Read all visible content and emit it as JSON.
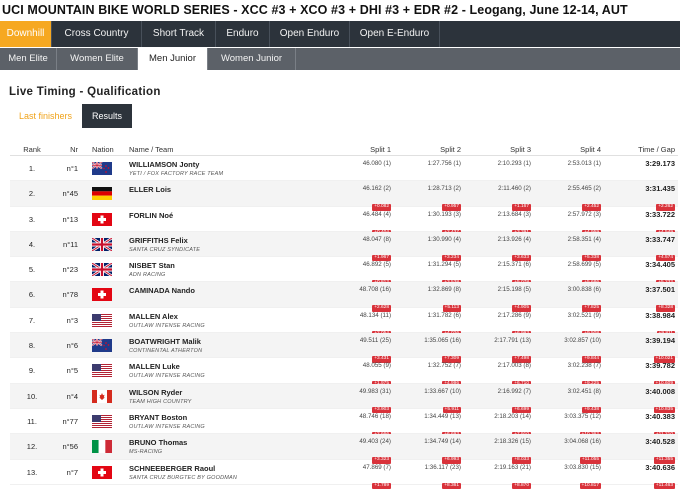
{
  "page": {
    "title": "UCI MOUNTAIN BIKE WORLD SERIES - XCC #3 + XCO #3 + DHI #3 + EDR #2 - Leogang, June 12-14, AUT"
  },
  "disciplines": [
    {
      "label": "Downhill",
      "active": true
    },
    {
      "label": "Cross Country",
      "active": false
    },
    {
      "label": "Short Track",
      "active": false
    },
    {
      "label": "Enduro",
      "active": false
    },
    {
      "label": "Open Enduro",
      "active": false
    },
    {
      "label": "Open E-Enduro",
      "active": false
    }
  ],
  "categories": [
    {
      "label": "Men Elite",
      "active": false
    },
    {
      "label": "Women Elite",
      "active": false
    },
    {
      "label": "Men Junior",
      "active": true
    },
    {
      "label": "Women Junior",
      "active": false
    }
  ],
  "section": {
    "title": "Live Timing - Qualification"
  },
  "subtabs": [
    {
      "label": "Last finishers",
      "active": false
    },
    {
      "label": "Results",
      "active": true
    }
  ],
  "colors": {
    "accent": "#f6a821",
    "nav_dark": "#2c333b",
    "nav_grey": "#5c6168",
    "gap_badge": "#d9323a"
  },
  "columns": {
    "rank": "Rank",
    "nr": "Nr",
    "nation": "Nation",
    "name_team": "Name / Team",
    "split1": "Split 1",
    "split2": "Split 2",
    "split3": "Split 3",
    "split4": "Split 4",
    "time_gap": "Time / Gap"
  },
  "rows": [
    {
      "rank": "1.",
      "nr": "n°1",
      "flag": "nz",
      "name": "WILLIAMSON Jonty",
      "team": "YETI / FOX FACTORY RACE TEAM",
      "s1": "46.080 (1)",
      "s1g": "",
      "s2": "1:27.756 (1)",
      "s2g": "",
      "s3": "2:10.293 (1)",
      "s3g": "",
      "s4": "2:53.013 (1)",
      "s4g": "",
      "time": "3:29.173",
      "gap": ""
    },
    {
      "rank": "2.",
      "nr": "n°45",
      "flag": "de",
      "name": "ELLER Lois",
      "team": "",
      "s1": "46.162 (2)",
      "s1g": "+0.082",
      "s2": "1:28.713 (2)",
      "s2g": "+0.957",
      "s3": "2:11.460 (2)",
      "s3g": "+1.167",
      "s4": "2:55.465 (2)",
      "s4g": "+2.452",
      "time": "3:31.435",
      "gap": "+2.262"
    },
    {
      "rank": "3.",
      "nr": "n°13",
      "flag": "ch",
      "name": "FORLIN Noé",
      "team": "",
      "s1": "46.484 (4)",
      "s1g": "+0.404",
      "s2": "1:30.193 (3)",
      "s2g": "+2.437",
      "s3": "2:13.684 (3)",
      "s3g": "+3.391",
      "s4": "2:57.972 (3)",
      "s4g": "+4.959",
      "time": "3:33.722",
      "gap": "+4.549"
    },
    {
      "rank": "4.",
      "nr": "n°11",
      "flag": "gb",
      "name": "GRIFFITHS Felix",
      "team": "SANTA CRUZ SYNDICATE",
      "s1": "48.047 (8)",
      "s1g": "+1.967",
      "s2": "1:30.990 (4)",
      "s2g": "+3.234",
      "s3": "2:13.926 (4)",
      "s3g": "+3.633",
      "s4": "2:58.351 (4)",
      "s4g": "+5.338",
      "time": "3:33.747",
      "gap": "+4.574"
    },
    {
      "rank": "5.",
      "nr": "n°23",
      "flag": "gb",
      "name": "NISBET Stan",
      "team": "ADN RACING",
      "s1": "46.892 (5)",
      "s1g": "+0.812",
      "s2": "1:31.294 (5)",
      "s2g": "+3.538",
      "s3": "2:15.371 (6)",
      "s3g": "+5.078",
      "s4": "2:58.699 (5)",
      "s4g": "+5.686",
      "time": "3:34.405",
      "gap": "+5.232"
    },
    {
      "rank": "6.",
      "nr": "n°78",
      "flag": "ch",
      "name": "CAMINADA Nando",
      "team": "",
      "s1": "48.708 (16)",
      "s1g": "+2.628",
      "s2": "1:32.869 (8)",
      "s2g": "+5.113",
      "s3": "2:15.198 (5)",
      "s3g": "+4.905",
      "s4": "3:00.838 (6)",
      "s4g": "+7.825",
      "time": "3:37.501",
      "gap": "+8.328"
    },
    {
      "rank": "7.",
      "nr": "n°3",
      "flag": "us",
      "name": "MALLEN Alex",
      "team": "OUTLAW INTENSE RACING",
      "s1": "48.134 (11)",
      "s1g": "+2.054",
      "s2": "1:31.782 (6)",
      "s2g": "+4.026",
      "s3": "2:17.286 (9)",
      "s3g": "+6.993",
      "s4": "3:02.521 (9)",
      "s4g": "+9.508",
      "time": "3:38.984",
      "gap": "+9.811"
    },
    {
      "rank": "8.",
      "nr": "n°6",
      "flag": "nz",
      "name": "BOATWRIGHT Malik",
      "team": "CONTINENTAL ATHERTON",
      "s1": "49.511 (25)",
      "s1g": "+3.431",
      "s2": "1:35.065 (16)",
      "s2g": "+7.309",
      "s3": "2:17.791 (13)",
      "s3g": "+7.498",
      "s4": "3:02.857 (10)",
      "s4g": "+9.844",
      "time": "3:39.194",
      "gap": "+10.021"
    },
    {
      "rank": "9.",
      "nr": "n°5",
      "flag": "us",
      "name": "MALLEN Luke",
      "team": "OUTLAW INTENSE RACING",
      "s1": "48.055 (9)",
      "s1g": "+1.975",
      "s2": "1:32.752 (7)",
      "s2g": "+4.996",
      "s3": "2:17.003 (8)",
      "s3g": "+6.710",
      "s4": "3:02.238 (7)",
      "s4g": "+9.225",
      "time": "3:39.782",
      "gap": "+10.609"
    },
    {
      "rank": "10.",
      "nr": "n°4",
      "flag": "ca",
      "name": "WILSON Ryder",
      "team": "TEAM HIGH COUNTRY",
      "s1": "49.983 (31)",
      "s1g": "+3.903",
      "s2": "1:33.667 (10)",
      "s2g": "+5.911",
      "s3": "2:16.992 (7)",
      "s3g": "+6.699",
      "s4": "3:02.451 (8)",
      "s4g": "+9.438",
      "time": "3:40.008",
      "gap": "+10.835"
    },
    {
      "rank": "11.",
      "nr": "n°77",
      "flag": "us",
      "name": "BRYANT Boston",
      "team": "OUTLAW INTENSE RACING",
      "s1": "48.746 (18)",
      "s1g": "+2.666",
      "s2": "1:34.449 (13)",
      "s2g": "+6.693",
      "s3": "2:18.203 (14)",
      "s3g": "+7.910",
      "s4": "3:03.375 (12)",
      "s4g": "+10.362",
      "time": "3:40.383",
      "gap": "+11.210"
    },
    {
      "rank": "12.",
      "nr": "n°56",
      "flag": "it",
      "name": "BRUNO Thomas",
      "team": "MS-RACING",
      "s1": "49.403 (24)",
      "s1g": "+3.323",
      "s2": "1:34.749 (14)",
      "s2g": "+6.993",
      "s3": "2:18.326 (15)",
      "s3g": "+8.033",
      "s4": "3:04.068 (16)",
      "s4g": "+11.055",
      "time": "3:40.528",
      "gap": "+11.355"
    },
    {
      "rank": "13.",
      "nr": "n°7",
      "flag": "ch",
      "name": "SCHNEEBERGER Raoul",
      "team": "SANTA CRUZ BURGTEC BY GOODMAN",
      "s1": "47.869 (7)",
      "s1g": "+1.789",
      "s2": "1:36.117 (23)",
      "s2g": "+8.361",
      "s3": "2:19.163 (21)",
      "s3g": "+8.870",
      "s4": "3:03.830 (15)",
      "s4g": "+10.817",
      "time": "3:40.636",
      "gap": "+11.463"
    }
  ]
}
